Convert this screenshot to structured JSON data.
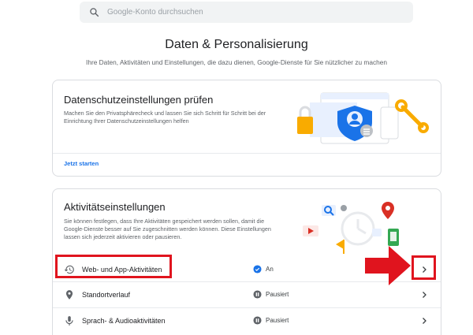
{
  "search": {
    "placeholder": "Google-Konto durchsuchen",
    "icon": "search-icon"
  },
  "page": {
    "title": "Daten & Personalisierung",
    "subtitle": "Ihre Daten, Aktivitäten und Einstellungen, die dazu dienen, Google-Dienste für Sie nützlicher zu machen"
  },
  "privacy_card": {
    "title": "Datenschutzeinstellungen prüfen",
    "text": "Machen Sie den Privatsphärecheck und lassen Sie sich Schritt für Schritt bei der Einrichtung Ihrer Datenschutzeinstellungen helfen",
    "link": "Jetzt starten"
  },
  "activity_card": {
    "title": "Aktivitätseinstellungen",
    "text": "Sie können festlegen, dass Ihre Aktivitäten gespeichert werden sollen, damit die Google-Dienste besser auf Sie zugeschnitten werden können. Diese Einstellungen lassen sich jederzeit aktivieren oder pausieren.",
    "rows": [
      {
        "label": "Web- und App-Aktivitäten",
        "status": "An",
        "icon": "history-icon",
        "status_icon": "check-circle-icon"
      },
      {
        "label": "Standortverlauf",
        "status": "Pausiert",
        "icon": "location-pin-icon",
        "status_icon": "pause-circle-icon"
      },
      {
        "label": "Sprach- & Audioaktivitäten",
        "status": "Pausiert",
        "icon": "microphone-icon",
        "status_icon": "pause-circle-icon"
      }
    ]
  },
  "colors": {
    "accent_blue": "#1a73e8",
    "highlight_red": "#e0141e",
    "text_secondary": "#5f6368"
  }
}
